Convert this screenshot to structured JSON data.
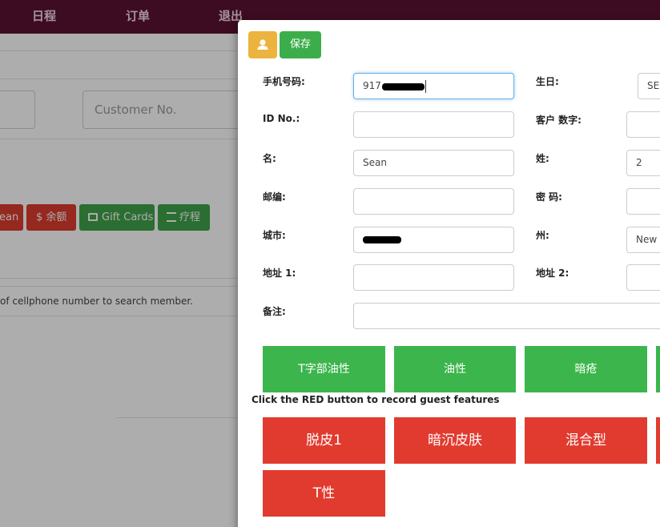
{
  "nav": {
    "items": [
      "日程",
      "订单",
      "退出"
    ]
  },
  "background": {
    "customer_no_placeholder": "Customer No.",
    "buttons": [
      {
        "label": "ean",
        "color": "red"
      },
      {
        "label": "$ 余额",
        "color": "red"
      },
      {
        "label": "Gift Cards",
        "color": "green"
      },
      {
        "label": "疗程",
        "color": "green"
      }
    ],
    "help_text": "of cellphone number to search member."
  },
  "modal": {
    "toolbar": {
      "save_label": "保存",
      "user_icon": "user-icon"
    },
    "fields": {
      "phone": {
        "label": "手机号码:",
        "value": "917"
      },
      "birthday": {
        "label": "生日:",
        "value": "SE"
      },
      "id_no": {
        "label": "ID No.:",
        "value": ""
      },
      "customer_number": {
        "label": "客户 数字:",
        "value": ""
      },
      "first_name": {
        "label": "名:",
        "value": "Sean"
      },
      "last_name": {
        "label": "姓:",
        "value": "2"
      },
      "zip": {
        "label": "邮编:",
        "value": ""
      },
      "password": {
        "label": "密 码:",
        "value": ""
      },
      "city": {
        "label": "城市:",
        "value": ""
      },
      "state": {
        "label": "州:",
        "value": "New"
      },
      "address1": {
        "label": "地址 1:",
        "value": ""
      },
      "address2": {
        "label": "地址 2:",
        "value": ""
      },
      "notes": {
        "label": "备注:",
        "value": ""
      }
    },
    "green_features": [
      "T字部油性",
      "油性",
      "暗疮"
    ],
    "hint": "Click the RED button to record guest features",
    "red_features": [
      "脱皮1",
      "暗沉皮肤",
      "混合型",
      "T性"
    ]
  },
  "colors": {
    "nav": "#5b1233",
    "green": "#3cb54d",
    "red": "#e13b2f",
    "yellow": "#ecb33e"
  }
}
